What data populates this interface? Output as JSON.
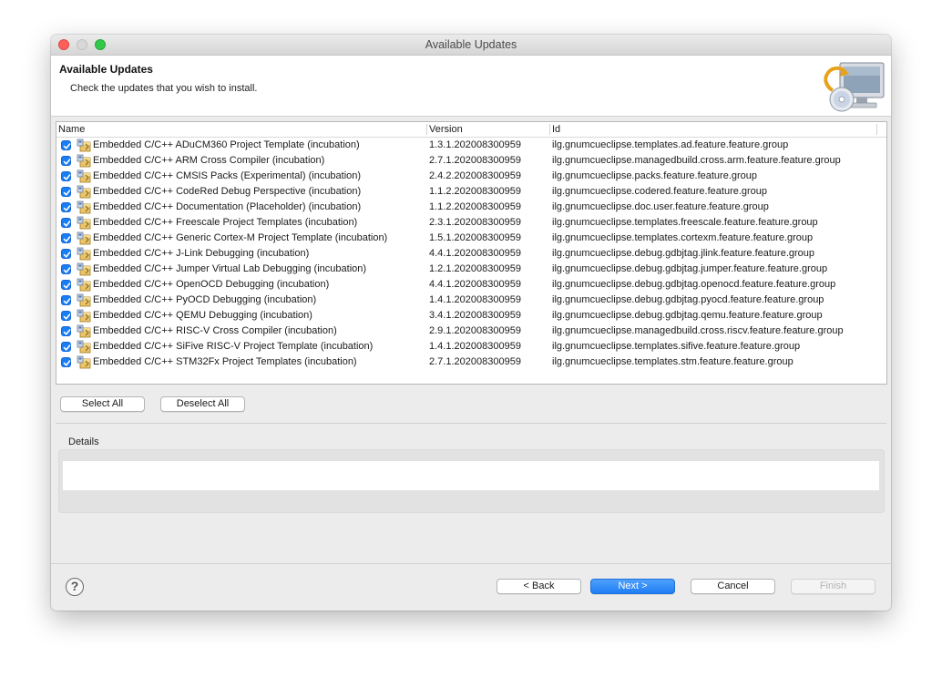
{
  "window": {
    "title": "Available Updates"
  },
  "header": {
    "title": "Available Updates",
    "subtitle": "Check the updates that you wish to install.",
    "icon": "update-computer-icon"
  },
  "table": {
    "columns": [
      "Name",
      "Version",
      "Id"
    ],
    "rows": [
      {
        "checked": true,
        "name": "Embedded C/C++ ADuCM360 Project Template (incubation)",
        "version": "1.3.1.202008300959",
        "id": "ilg.gnumcueclipse.templates.ad.feature.feature.group"
      },
      {
        "checked": true,
        "name": "Embedded C/C++ ARM Cross Compiler (incubation)",
        "version": "2.7.1.202008300959",
        "id": "ilg.gnumcueclipse.managedbuild.cross.arm.feature.feature.group"
      },
      {
        "checked": true,
        "name": "Embedded C/C++ CMSIS Packs (Experimental) (incubation)",
        "version": "2.4.2.202008300959",
        "id": "ilg.gnumcueclipse.packs.feature.feature.group"
      },
      {
        "checked": true,
        "name": "Embedded C/C++ CodeRed Debug Perspective (incubation)",
        "version": "1.1.2.202008300959",
        "id": "ilg.gnumcueclipse.codered.feature.feature.group"
      },
      {
        "checked": true,
        "name": "Embedded C/C++ Documentation (Placeholder) (incubation)",
        "version": "1.1.2.202008300959",
        "id": "ilg.gnumcueclipse.doc.user.feature.feature.group"
      },
      {
        "checked": true,
        "name": "Embedded C/C++ Freescale Project Templates (incubation)",
        "version": "2.3.1.202008300959",
        "id": "ilg.gnumcueclipse.templates.freescale.feature.feature.group"
      },
      {
        "checked": true,
        "name": "Embedded C/C++ Generic Cortex-M Project Template (incubation)",
        "version": "1.5.1.202008300959",
        "id": "ilg.gnumcueclipse.templates.cortexm.feature.feature.group"
      },
      {
        "checked": true,
        "name": "Embedded C/C++ J-Link Debugging (incubation)",
        "version": "4.4.1.202008300959",
        "id": "ilg.gnumcueclipse.debug.gdbjtag.jlink.feature.feature.group"
      },
      {
        "checked": true,
        "name": "Embedded C/C++ Jumper Virtual Lab Debugging (incubation)",
        "version": "1.2.1.202008300959",
        "id": "ilg.gnumcueclipse.debug.gdbjtag.jumper.feature.feature.group"
      },
      {
        "checked": true,
        "name": "Embedded C/C++ OpenOCD Debugging (incubation)",
        "version": "4.4.1.202008300959",
        "id": "ilg.gnumcueclipse.debug.gdbjtag.openocd.feature.feature.group"
      },
      {
        "checked": true,
        "name": "Embedded C/C++ PyOCD Debugging (incubation)",
        "version": "1.4.1.202008300959",
        "id": "ilg.gnumcueclipse.debug.gdbjtag.pyocd.feature.feature.group"
      },
      {
        "checked": true,
        "name": "Embedded C/C++ QEMU Debugging (incubation)",
        "version": "3.4.1.202008300959",
        "id": "ilg.gnumcueclipse.debug.gdbjtag.qemu.feature.feature.group"
      },
      {
        "checked": true,
        "name": "Embedded C/C++ RISC-V Cross Compiler (incubation)",
        "version": "2.9.1.202008300959",
        "id": "ilg.gnumcueclipse.managedbuild.cross.riscv.feature.feature.group"
      },
      {
        "checked": true,
        "name": "Embedded C/C++ SiFive RISC-V Project Template (incubation)",
        "version": "1.4.1.202008300959",
        "id": "ilg.gnumcueclipse.templates.sifive.feature.feature.group"
      },
      {
        "checked": true,
        "name": "Embedded C/C++ STM32Fx Project Templates (incubation)",
        "version": "2.7.1.202008300959",
        "id": "ilg.gnumcueclipse.templates.stm.feature.feature.group"
      }
    ]
  },
  "selection": {
    "select_all": "Select All",
    "deselect_all": "Deselect All"
  },
  "details": {
    "label": "Details",
    "text": ""
  },
  "footer": {
    "help_icon": "help-icon",
    "help_glyph": "?",
    "back": "< Back",
    "next": "Next >",
    "cancel": "Cancel",
    "finish": "Finish"
  },
  "colors": {
    "accent": "#1f7ef5",
    "checkbox": "#1a7ef2",
    "window_bg": "#ececec",
    "close": "#fc605b",
    "maximize": "#34c84a"
  }
}
